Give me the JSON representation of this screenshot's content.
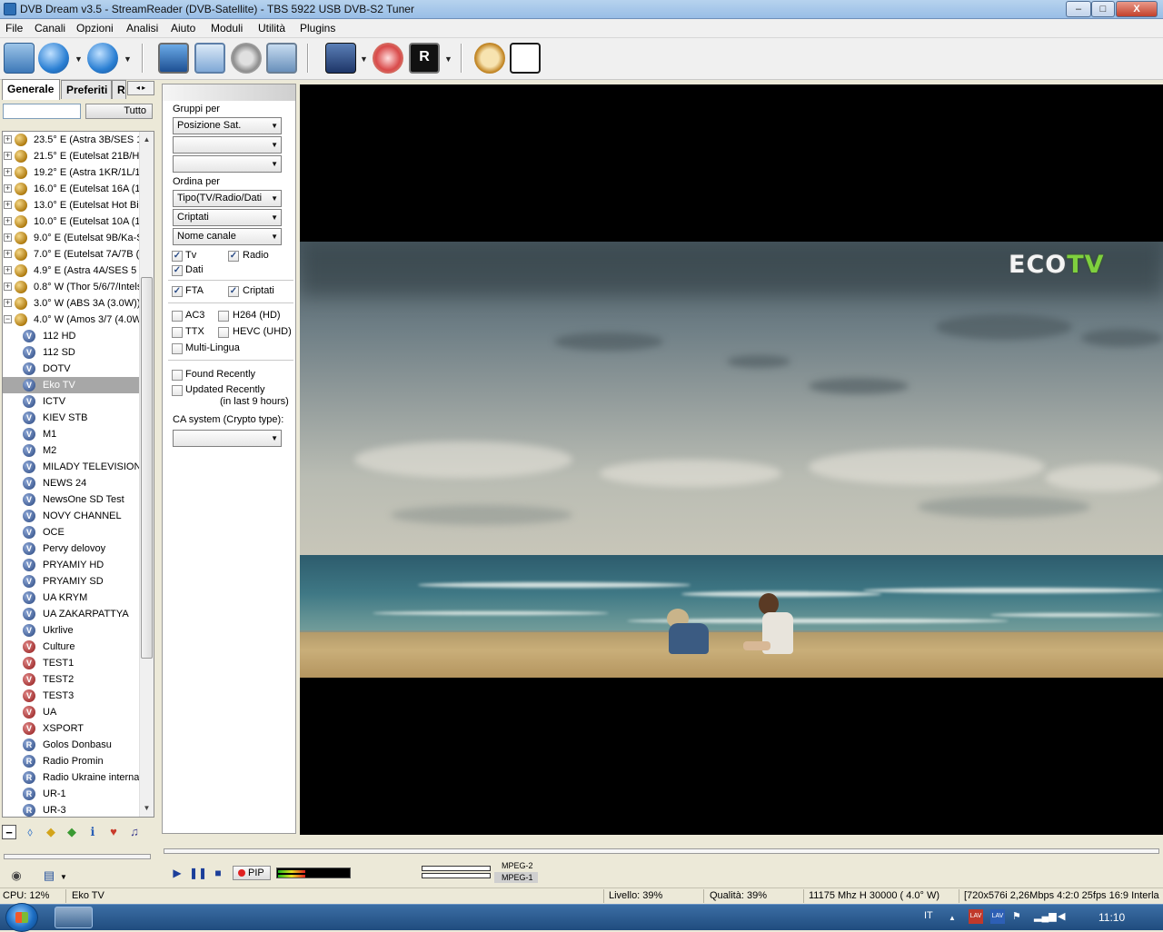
{
  "window": {
    "title": "DVB Dream v3.5   -  StreamReader (DVB-Satellite)  -  TBS 5922 USB DVB-S2 Tuner",
    "minimize": "–",
    "maximize": "□",
    "close": "X"
  },
  "menu": [
    "File",
    "Canali",
    "Opzioni",
    "Analisi",
    "Aiuto",
    "Moduli",
    "Utilità",
    "Plugins"
  ],
  "toolbar_icons": [
    "open-channel-icon",
    "back-icon",
    "forward-icon",
    "monitor-icon",
    "screen-icon",
    "settings-gears-icon",
    "osd-icon",
    "clapperboard-icon",
    "cancel-record-icon",
    "record-r-icon",
    "timer-icon",
    "epg-clock-icon"
  ],
  "left_panel": {
    "tabs": [
      "Generale",
      "Preferiti",
      "R"
    ],
    "search_value": "",
    "tutto_label": "Tutto"
  },
  "satellites": [
    "23.5° E (Astra 3B/SES 1",
    "21.5° E (Eutelsat 21B/Hy",
    "19.2° E (Astra 1KR/1L/1",
    "16.0° E (Eutelsat 16A (1",
    "13.0° E (Eutelsat Hot Bir",
    "10.0° E (Eutelsat 10A (1",
    "9.0° E (Eutelsat 9B/Ka-S",
    "7.0° E (Eutelsat 7A/7B (",
    "4.9° E (Astra 4A/SES 5",
    "0.8° W (Thor 5/6/7/Intels",
    "3.0° W (ABS 3A (3.0W))",
    "4.0° W (Amos 3/7 (4.0W"
  ],
  "channels": [
    {
      "name": "112 HD",
      "kind": "tv",
      "glyph": "V"
    },
    {
      "name": "112 SD",
      "kind": "tv",
      "glyph": "V"
    },
    {
      "name": "DOTV",
      "kind": "tv",
      "glyph": "V"
    },
    {
      "name": "Eko TV",
      "kind": "tv",
      "glyph": "V",
      "selected": true
    },
    {
      "name": "ICTV",
      "kind": "tv",
      "glyph": "V"
    },
    {
      "name": "KIEV STB",
      "kind": "tv",
      "glyph": "V"
    },
    {
      "name": "M1",
      "kind": "tv",
      "glyph": "V"
    },
    {
      "name": "M2",
      "kind": "tv",
      "glyph": "V"
    },
    {
      "name": "MILADY TELEVISION",
      "kind": "tv",
      "glyph": "V"
    },
    {
      "name": "NEWS 24",
      "kind": "tv",
      "glyph": "V"
    },
    {
      "name": "NewsOne SD Test",
      "kind": "tv",
      "glyph": "V"
    },
    {
      "name": "NOVY CHANNEL",
      "kind": "tv",
      "glyph": "V"
    },
    {
      "name": "OCE",
      "kind": "tv",
      "glyph": "V"
    },
    {
      "name": "Pervy delovoy",
      "kind": "tv",
      "glyph": "V"
    },
    {
      "name": "PRYAMIY HD",
      "kind": "tv",
      "glyph": "V"
    },
    {
      "name": "PRYAMIY SD",
      "kind": "tv",
      "glyph": "V"
    },
    {
      "name": "UA KRYM",
      "kind": "tv",
      "glyph": "V"
    },
    {
      "name": "UA ZAKARPATTYA",
      "kind": "tv",
      "glyph": "V"
    },
    {
      "name": "Ukrlive",
      "kind": "tv",
      "glyph": "V"
    },
    {
      "name": "Culture",
      "kind": "crypt",
      "glyph": "V"
    },
    {
      "name": "TEST1",
      "kind": "crypt",
      "glyph": "V"
    },
    {
      "name": "TEST2",
      "kind": "crypt",
      "glyph": "V"
    },
    {
      "name": "TEST3",
      "kind": "crypt",
      "glyph": "V"
    },
    {
      "name": "UA",
      "kind": "crypt",
      "glyph": "V"
    },
    {
      "name": "XSPORT",
      "kind": "crypt",
      "glyph": "V"
    },
    {
      "name": "Golos Donbasu",
      "kind": "radio",
      "glyph": "R"
    },
    {
      "name": "Radio Promin",
      "kind": "radio",
      "glyph": "R"
    },
    {
      "name": "Radio Ukraine internat",
      "kind": "radio",
      "glyph": "R"
    },
    {
      "name": "UR-1",
      "kind": "radio",
      "glyph": "R"
    },
    {
      "name": "UR-3",
      "kind": "radio",
      "glyph": "R"
    }
  ],
  "filters": {
    "group_label": "Gruppi per",
    "group_1": "Posizione Sat.",
    "group_2": "",
    "group_3": "",
    "order_label": "Ordina per",
    "order_1": "Tipo(TV/Radio/Dati",
    "order_2": "Criptati",
    "order_3": "Nome canale",
    "tv": "Tv",
    "tv_checked": true,
    "radio": "Radio",
    "radio_checked": true,
    "dati": "Dati",
    "dati_checked": true,
    "fta": "FTA",
    "fta_checked": true,
    "criptati": "Criptati",
    "criptati_checked": true,
    "ac3": "AC3",
    "ac3_checked": false,
    "h264": "H264 (HD)",
    "h264_checked": false,
    "ttx": "TTX",
    "ttx_checked": false,
    "hevc": "HEVC (UHD)",
    "hevc_checked": false,
    "multilingua": "Multi-Lingua",
    "multilingua_checked": false,
    "found_recently": "Found Recently",
    "found_checked": false,
    "updated_recently": "Updated Recently",
    "updated_checked": false,
    "updated_hint": "(in last 9 hours)",
    "ca_label": "CA system (Crypto type):",
    "ca_value": ""
  },
  "video": {
    "logo_eco": "ECO",
    "logo_tv": "TV"
  },
  "transport": {
    "pip_label": "PIP",
    "fmt1": "MPEG-2",
    "fmt2": "MPEG-1"
  },
  "status": {
    "cpu": "CPU: 12%",
    "channel": "Eko TV",
    "level": "Livello: 39%",
    "quality": "Qualità: 39%",
    "tuning": "11175 Mhz  H  30000  ( 4.0° W)",
    "stream_info": "[720x576i  2,26Mbps 4:2:0 25fps 16:9 Interla"
  },
  "taskbar": {
    "lang": "IT",
    "clock": "11:10"
  }
}
